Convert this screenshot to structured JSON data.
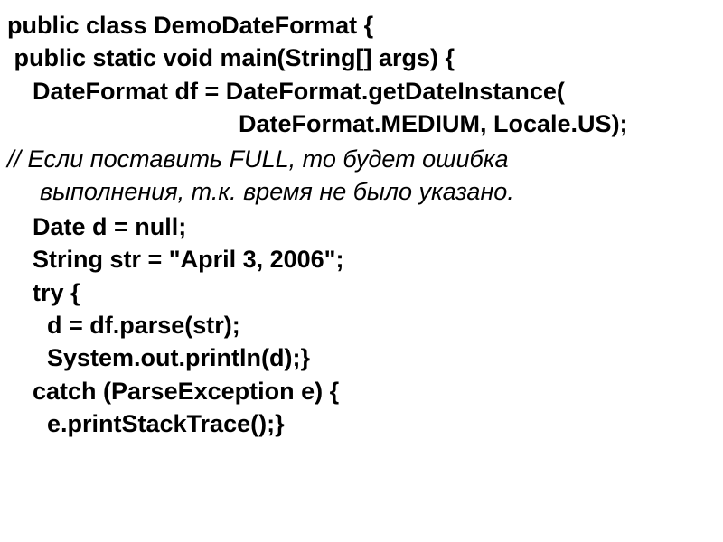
{
  "code": {
    "l1": "public class DemoDateFormat {",
    "l2": " public static void main(String[] args) {",
    "l3": "DateFormat df = DateFormat.getDateInstance(",
    "l4": "DateFormat.MEDIUM, Locale.US);",
    "comment1": "// Если поставить FULL, то будет ошибка",
    "comment2": "выполнения, т.к. время не было указано.",
    "l5": "Date d = null;",
    "l6": "String str = \"April 3, 2006\";",
    "l7": "try {",
    "l8": "d = df.parse(str);",
    "l9": "System.out.println(d);}",
    "l10": "catch (ParseException e) {",
    "l11": "e.printStackTrace();}"
  }
}
